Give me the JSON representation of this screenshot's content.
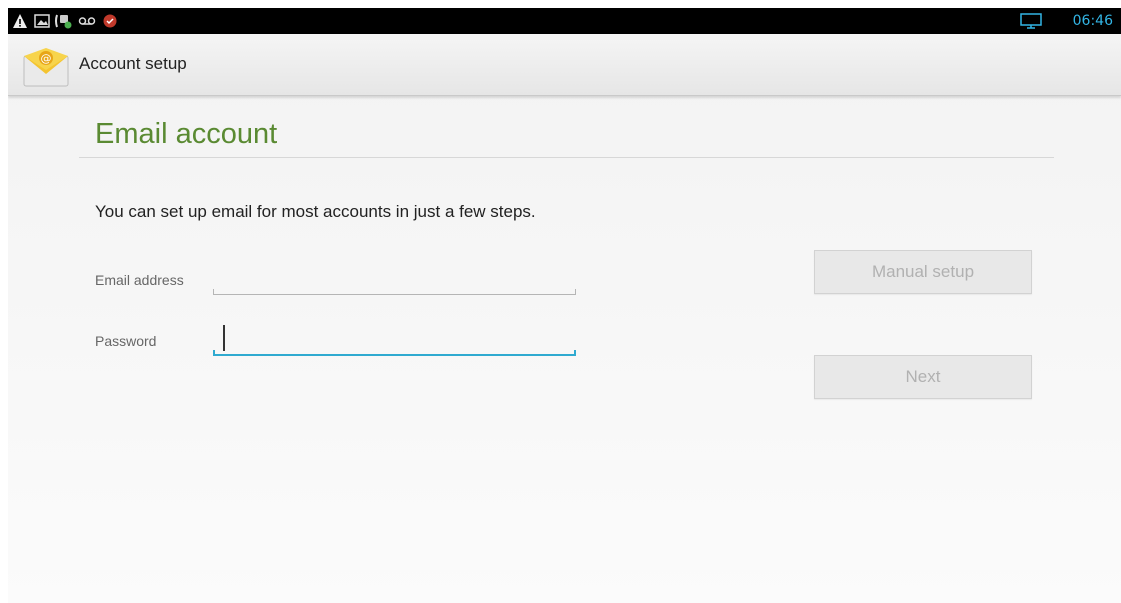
{
  "status_bar": {
    "time": "06:46",
    "left_icons": [
      "warning-icon",
      "image-icon",
      "call-icon",
      "voicemail-icon",
      "app-notification-icon"
    ],
    "right_icons": [
      "screen-share-icon"
    ],
    "accent_color": "#33b5e5"
  },
  "action_bar": {
    "title": "Account setup",
    "app_icon": "email-app-icon"
  },
  "page": {
    "title": "Email account",
    "title_color": "#5a8a32",
    "instructions": "You can set up email for most accounts in just a few steps."
  },
  "form": {
    "email_label": "Email address",
    "email_value": "",
    "password_label": "Password",
    "password_value": "",
    "focus_color": "#2faad0"
  },
  "buttons": {
    "manual_setup": "Manual setup",
    "next": "Next"
  }
}
